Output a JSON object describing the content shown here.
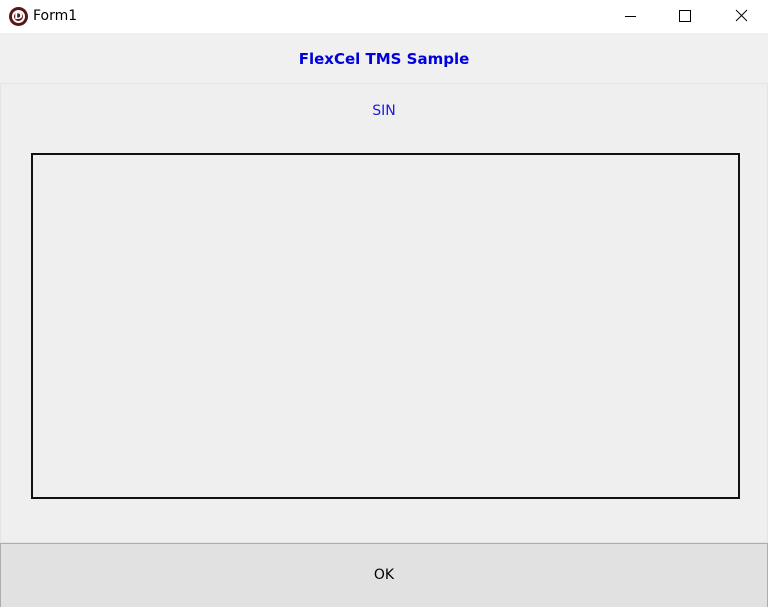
{
  "window": {
    "title": "Form1",
    "icon": "delphi-app-icon",
    "icon_letter": "D",
    "controls": [
      "minimize-icon",
      "maximize-icon",
      "close-icon"
    ]
  },
  "header": {
    "title": "FlexCel TMS Sample"
  },
  "chart": {
    "label": "SIN"
  },
  "footer": {
    "ok_label": "OK"
  },
  "colors": {
    "title_blue": "#0000dd",
    "label_blue": "#1a1adf",
    "icon_brown": "#5a1616",
    "panel_bg": "#f0f0f0",
    "button_bg": "#e1e1e1"
  }
}
